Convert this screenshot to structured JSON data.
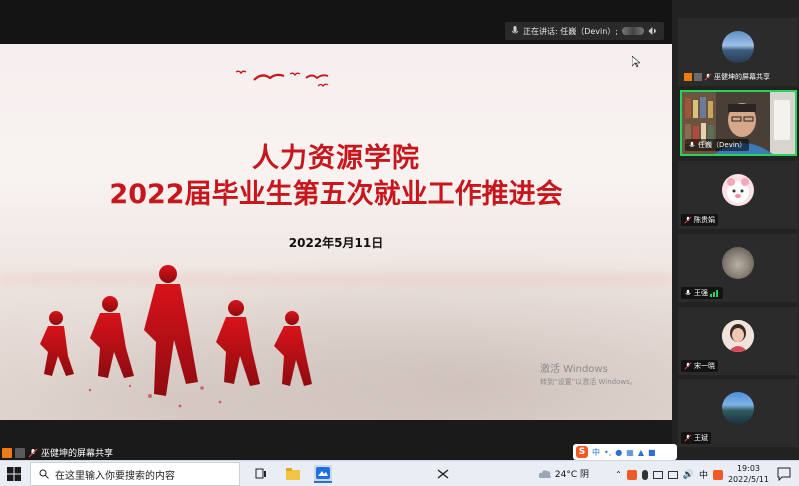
{
  "meeting": {
    "speaking_text": "正在讲话: 任巍（Devin）;",
    "share_label": "巫健坤的屏幕共享"
  },
  "slide": {
    "title_line1": "人力资源学院",
    "title_line2": "2022届毕业生第五次就业工作推进会",
    "date": "2022年5月11日",
    "accent_color": "#c8161d",
    "watermark_line1": "激活 Windows",
    "watermark_line2": "转到“设置”以激活 Windows。"
  },
  "participants": [
    {
      "name": "巫健坤的屏幕共享",
      "avatar": "landscape-avatar",
      "mic": "sharing"
    },
    {
      "name": "任巍（Devin）",
      "avatar": "video-feed",
      "mic": "on",
      "active_speaker": true
    },
    {
      "name": "陈贵娟",
      "avatar": "cartoon-avatar",
      "mic": "muted"
    },
    {
      "name": "王强",
      "avatar": "moon-avatar",
      "mic": "on"
    },
    {
      "name": "宋一晓",
      "avatar": "photo-avatar",
      "mic": "muted"
    },
    {
      "name": "王斌",
      "avatar": "lake-avatar",
      "mic": "muted"
    }
  ],
  "taskbar": {
    "search_placeholder": "在这里输入你要搜索的内容",
    "weather": "24°C 阴",
    "ime": "中",
    "time": "19:03",
    "date": "2022/5/11",
    "accent_green": "#29d35b"
  }
}
